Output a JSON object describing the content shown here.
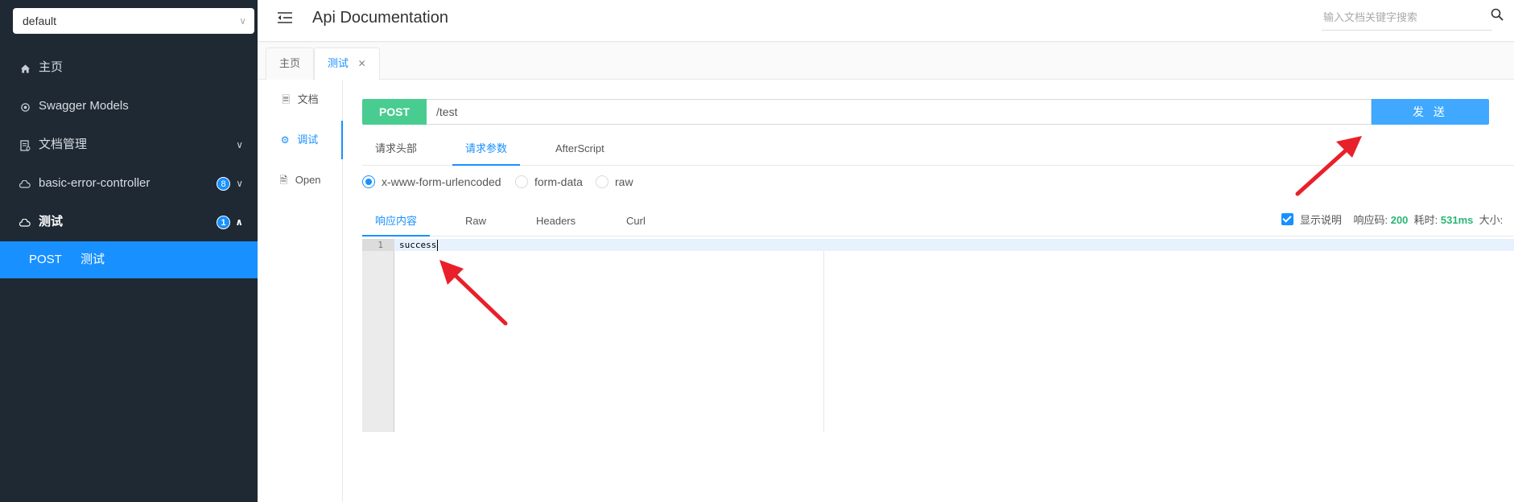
{
  "sidebar": {
    "group_select": "default",
    "items": [
      {
        "label": "主页",
        "icon": "home-icon"
      },
      {
        "label": "Swagger Models",
        "icon": "model-icon"
      },
      {
        "label": "文档管理",
        "icon": "document-manage-icon"
      },
      {
        "label": "basic-error-controller",
        "icon": "cloud-icon",
        "badge": "8"
      },
      {
        "label": "测试",
        "icon": "cloud-icon",
        "badge": "1"
      }
    ],
    "active_sub": {
      "method": "POST",
      "label": "测试"
    }
  },
  "header": {
    "title": "Api Documentation",
    "search_placeholder": "输入文档关键字搜索"
  },
  "tabs": [
    {
      "label": "主页"
    },
    {
      "label": "测试",
      "close": "✕"
    }
  ],
  "vnav": [
    {
      "label": "文档"
    },
    {
      "label": "调试"
    },
    {
      "label": "Open"
    }
  ],
  "request": {
    "method": "POST",
    "url": "/test",
    "send_label": "发 送",
    "method_color": "#49cc90",
    "send_color": "#40a9ff"
  },
  "request_tabs": [
    "请求头部",
    "请求参数",
    "AfterScript"
  ],
  "content_types": [
    "x-www-form-urlencoded",
    "form-data",
    "raw"
  ],
  "response": {
    "tabs": [
      "响应内容",
      "Raw",
      "Headers",
      "Curl"
    ],
    "show_desc_label": "显示说明",
    "code_label": "响应码:",
    "code": "200",
    "time_label": "耗时:",
    "time": "531ms",
    "size_label": "大小:",
    "line_number": "1",
    "body": "success"
  },
  "accent_color": "#1890ff"
}
